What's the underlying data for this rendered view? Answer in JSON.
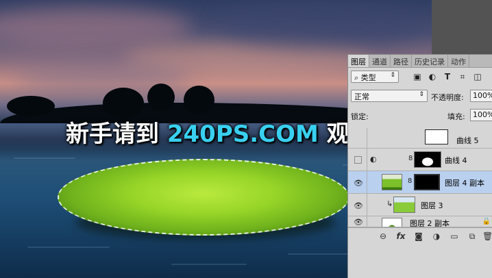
{
  "watermark": {
    "prefix": "新手请到 ",
    "site": "240PS.COM",
    "suffix": " 观看视频教程"
  },
  "panel": {
    "tabs": [
      "图层",
      "通道",
      "路径",
      "历史记录",
      "动作"
    ],
    "filter": {
      "icon": "search-icon",
      "value": "类型"
    },
    "blend_mode": "正常",
    "opacity_label": "不透明度:",
    "opacity_value": "100%",
    "lock_label": "锁定:",
    "fill_label": "填充:",
    "fill_value": "100%",
    "layers": [
      {
        "name": "曲线 5",
        "visible": false
      },
      {
        "name": "曲线 4",
        "visible": false
      },
      {
        "name": "图层 4 副本",
        "visible": true,
        "selected": true
      },
      {
        "name": "图层 3",
        "visible": true
      },
      {
        "name": "图层 2 副本",
        "visible": true
      }
    ],
    "bottom_icons": [
      "link-icon",
      "fx-icon",
      "mask-icon",
      "adjustment-icon",
      "folder-icon",
      "new-layer-icon",
      "trash-icon"
    ]
  }
}
